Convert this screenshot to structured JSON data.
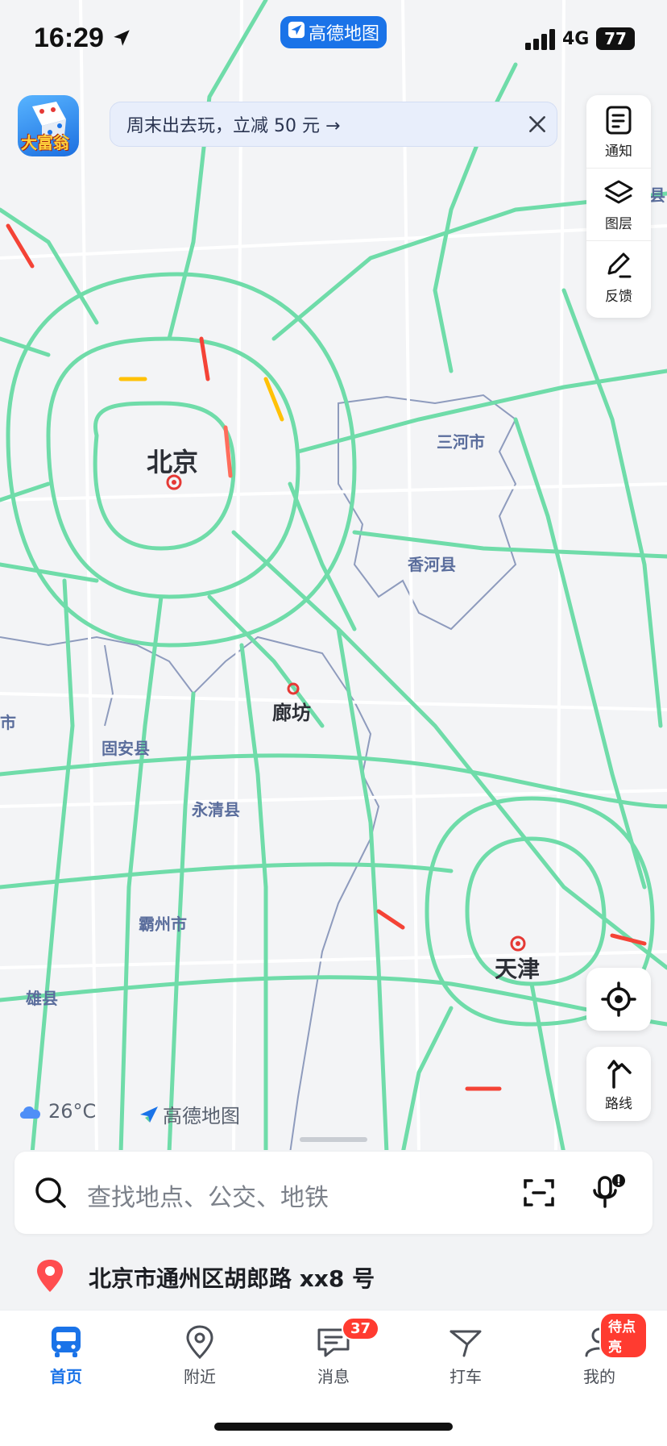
{
  "status_bar": {
    "time": "16:29",
    "carrier": "4G",
    "battery": "77"
  },
  "app_pill": {
    "label": "高德地图"
  },
  "promo": {
    "text": "周末出去玩，立减 50 元 →"
  },
  "game_icon": {
    "title": "大富翁"
  },
  "tools": {
    "notify": "通知",
    "layers": "图层",
    "feedback": "反馈"
  },
  "route_button": {
    "label": "路线"
  },
  "map": {
    "cities": {
      "beijing": "北京",
      "langfang": "廊坊",
      "tianjin": "天津"
    },
    "counties": {
      "sanhe": "三河市",
      "xianghe": "香河县",
      "guan": "固安县",
      "yongqing": "永清县",
      "bazhou": "霸州市",
      "xiongxian": "雄县",
      "edge_left": "市",
      "edge_right": "县"
    }
  },
  "weather": {
    "temp": "26°C"
  },
  "brand": {
    "label": "高德地图"
  },
  "search": {
    "placeholder": "查找地点、公交、地铁"
  },
  "location": {
    "address": "北京市通州区胡郎路 xx8 号"
  },
  "tabbar": {
    "home": "首页",
    "nearby": "附近",
    "messages": "消息",
    "taxi": "打车",
    "mine": "我的",
    "messages_badge": "37",
    "mine_badge": "待点亮"
  },
  "colors": {
    "accent": "#1a73e8",
    "road_green": "#6fdca9",
    "badge_red": "#ff3b30"
  }
}
